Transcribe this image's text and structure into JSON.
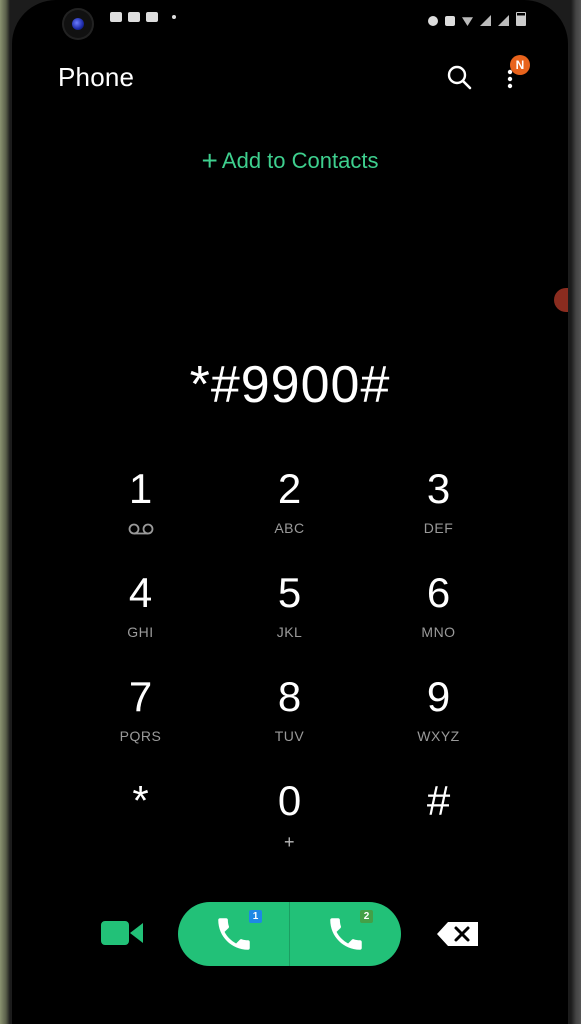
{
  "header": {
    "title": "Phone",
    "notification_badge": "N"
  },
  "add_contacts": {
    "plus": "+",
    "label": "Add to Contacts"
  },
  "dialed_number": "*#9900#",
  "keypad": [
    {
      "digit": "1",
      "letters": ""
    },
    {
      "digit": "2",
      "letters": "ABC"
    },
    {
      "digit": "3",
      "letters": "DEF"
    },
    {
      "digit": "4",
      "letters": "GHI"
    },
    {
      "digit": "5",
      "letters": "JKL"
    },
    {
      "digit": "6",
      "letters": "MNO"
    },
    {
      "digit": "7",
      "letters": "PQRS"
    },
    {
      "digit": "8",
      "letters": "TUV"
    },
    {
      "digit": "9",
      "letters": "WXYZ"
    },
    {
      "digit": "*",
      "letters": ""
    },
    {
      "digit": "0",
      "letters": "+"
    },
    {
      "digit": "#",
      "letters": ""
    }
  ],
  "call": {
    "sim1_label": "1",
    "sim2_label": "2"
  },
  "colors": {
    "accent_green": "#22c178",
    "add_contacts_green": "#3ecf8e",
    "badge_orange": "#e8631c",
    "sim1_blue": "#1e88e5",
    "sim2_green": "#43a047"
  },
  "icons": [
    "search-icon",
    "more-options-icon",
    "voicemail-icon",
    "video-call-icon",
    "phone-icon",
    "backspace-icon"
  ]
}
